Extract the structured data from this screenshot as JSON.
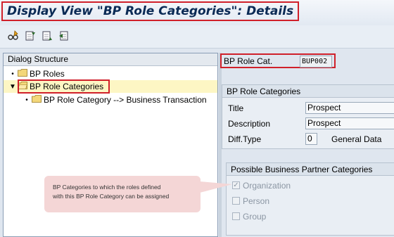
{
  "title": "Display View \"BP Role Categories\": Details",
  "toolbar": {
    "icons": [
      "glasses-edit-icon",
      "previous-entry-icon",
      "next-entry-icon",
      "other-entry-icon"
    ]
  },
  "dialog_structure": {
    "header": "Dialog Structure",
    "items": [
      {
        "label": "BP Roles"
      },
      {
        "label": "BP Role Categories",
        "selected": true
      },
      {
        "label": "BP Role Category --> Business Transaction"
      }
    ]
  },
  "role_cat": {
    "label": "BP Role Cat.",
    "value": "BUP002"
  },
  "categories_group": {
    "title": "BP Role Categories",
    "title_label": "Title",
    "title_value": "Prospect",
    "description_label": "Description",
    "description_value": "Prospect",
    "diff_type_label": "Diff.Type",
    "diff_type_value": "0",
    "diff_type_text": "General Data"
  },
  "possible_group": {
    "title": "Possible Business Partner Categories",
    "options": [
      {
        "label": "Organization",
        "checked": true
      },
      {
        "label": "Person",
        "checked": false
      },
      {
        "label": "Group",
        "checked": false
      }
    ]
  },
  "callout": {
    "line1": "BP Categories to which the roles defined",
    "line2": "with this BP Role Category can be assigned"
  },
  "colors": {
    "highlight_red": "#d0202a",
    "selection_yellow": "#fdf6c4",
    "callout_pink": "#f4d6d6"
  }
}
